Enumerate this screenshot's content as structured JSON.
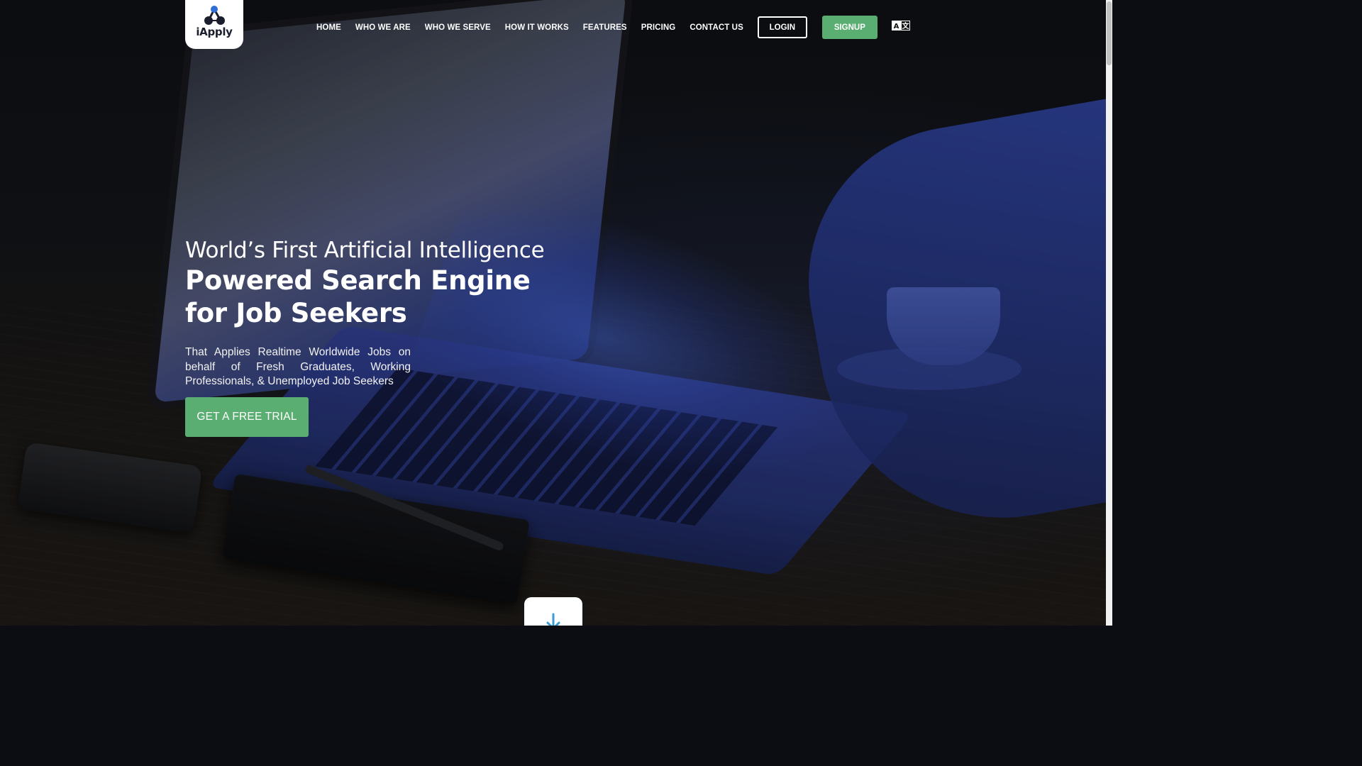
{
  "brand": {
    "logo_text": "iApply",
    "accent_color": "#5aae72"
  },
  "nav": {
    "items": [
      {
        "label": "HOME"
      },
      {
        "label": "WHO WE ARE"
      },
      {
        "label": "WHO WE SERVE"
      },
      {
        "label": "HOW IT WORKS"
      },
      {
        "label": "FEATURES"
      },
      {
        "label": "PRICING"
      },
      {
        "label": "CONTACT US"
      }
    ],
    "login_label": "LOGIN",
    "signup_label": "SIGNUP",
    "language_icon": "translate-icon"
  },
  "hero": {
    "line1": "World’s First Artificial Intelligence",
    "line2": "Powered Search Engine",
    "line3": "for Job Seekers",
    "subtitle": "That Applies Realtime Worldwide Jobs on behalf of Fresh Graduates, Working Professionals, & Unemployed Job Seekers",
    "cta_label": "GET A FREE TRIAL"
  },
  "scroll": {
    "icon": "arrow-down-icon"
  }
}
